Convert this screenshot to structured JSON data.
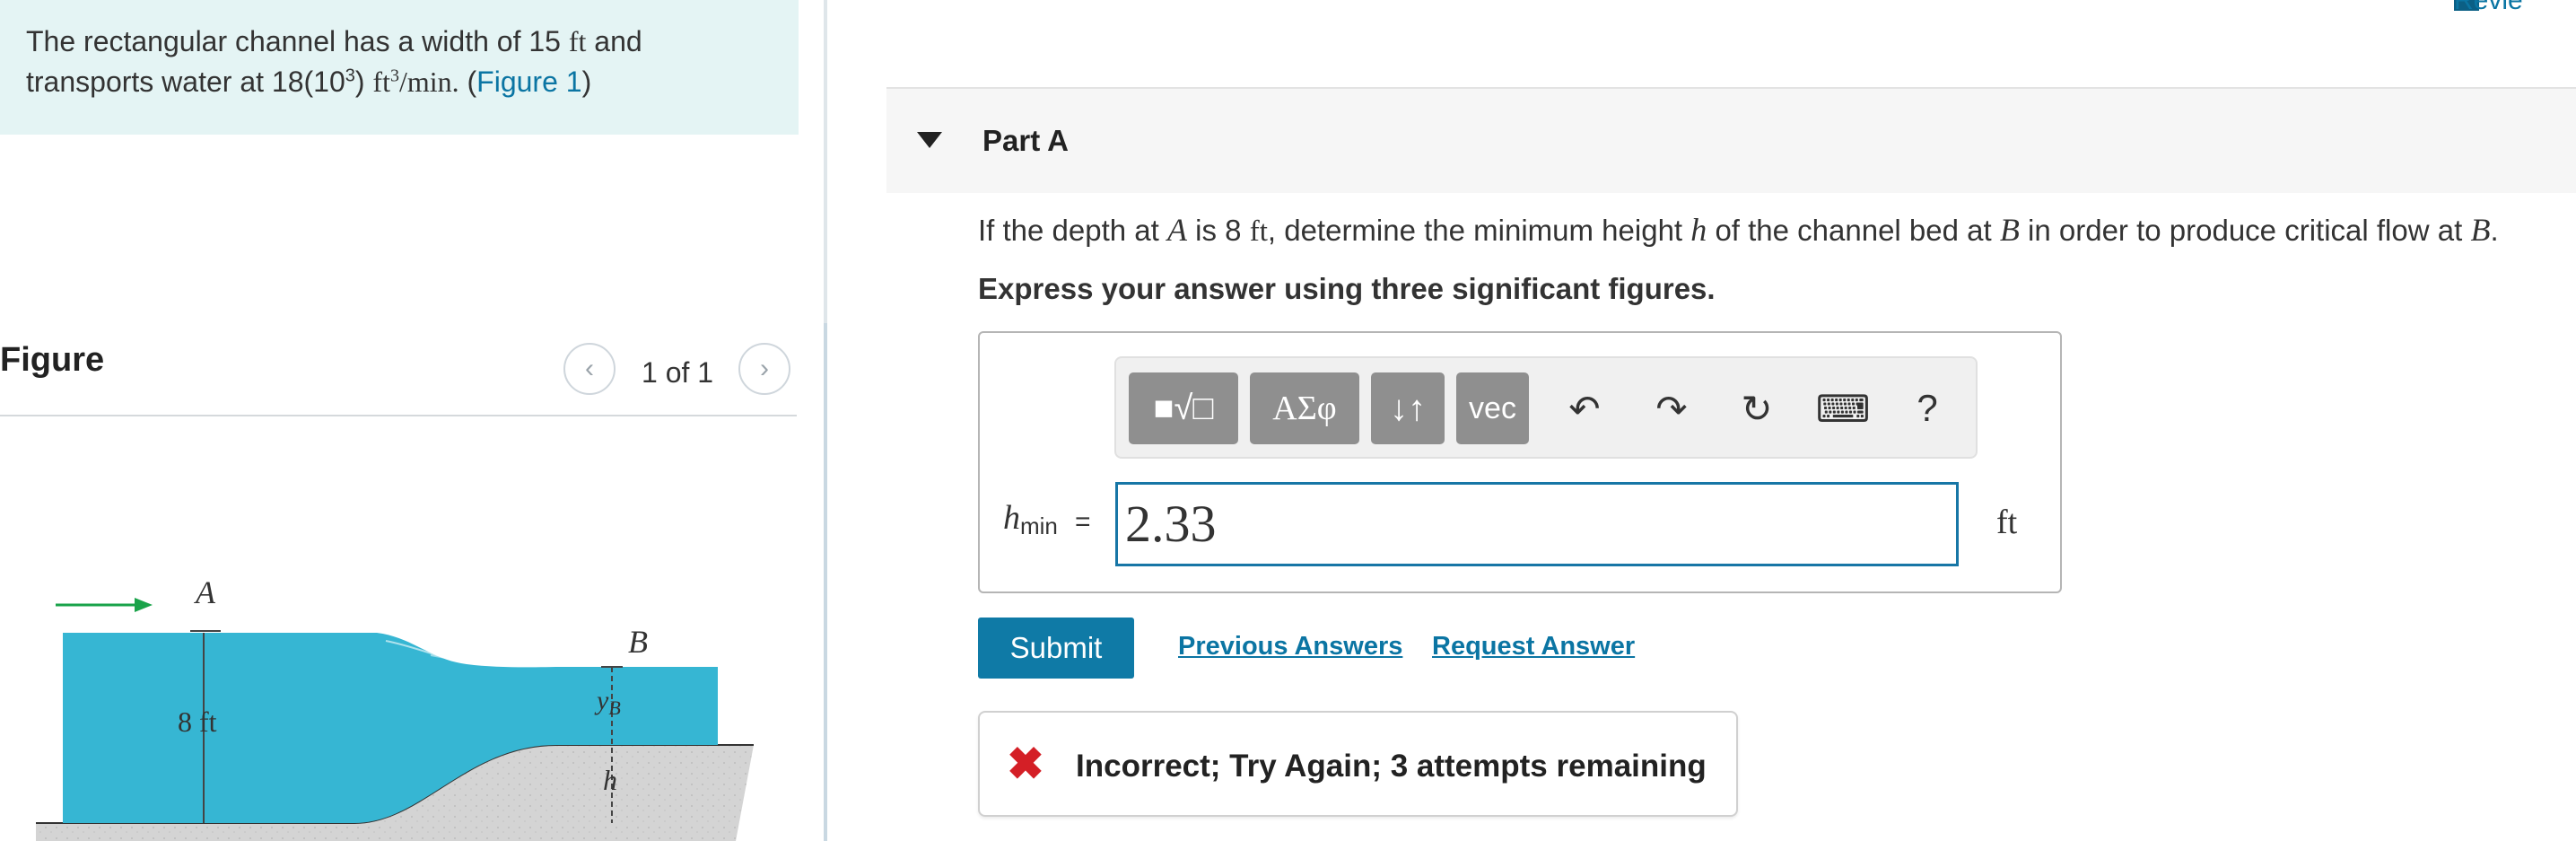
{
  "problem": {
    "line1_pre": "The rectangular channel has a width of 15",
    "line1_unit": "ft",
    "line1_post": "and",
    "line2_pre": "transports water at 18(10",
    "line2_exp": "3",
    "line2_mid": ")",
    "line2_unit": "ft",
    "line2_unit_exp": "3",
    "line2_rate": "/min.",
    "line2_open": "(",
    "figure_link": "Figure 1",
    "line2_close": ")"
  },
  "figure": {
    "title": "Figure",
    "counter": "1 of 1",
    "label_A": "A",
    "label_B": "B",
    "label_depth": "8 ft",
    "label_yB": "y",
    "label_yB_sub": "B",
    "label_h": "h"
  },
  "header": {
    "review_label": "Revie"
  },
  "part": {
    "label": "Part A",
    "question_1": "If the depth at",
    "question_A": "A",
    "question_2": "is 8",
    "question_ft": "ft",
    "question_3": ", determine the minimum height",
    "question_h": "h",
    "question_4": "of the channel bed at",
    "question_B": "B",
    "question_5": "in order to produce critical flow at",
    "question_B2": "B",
    "question_6": ".",
    "instruction": "Express your answer using three significant figures."
  },
  "toolbar": {
    "templates": "■√□",
    "symbols": "ΑΣφ",
    "arrows": "↓↑",
    "vec": "vec",
    "help": "?"
  },
  "answer": {
    "var": "h",
    "var_sub": "min",
    "equals": "=",
    "value": "2.33",
    "unit": "ft"
  },
  "actions": {
    "submit": "Submit",
    "previous_answers": "Previous Answers",
    "request_answer": "Request Answer"
  },
  "feedback": {
    "icon": "✖",
    "text": "Incorrect; Try Again; 3 attempts remaining",
    "status_color": "#d41f26"
  },
  "colors": {
    "accent": "#0f7aa6",
    "problem_bg": "#e4f4f4",
    "water": "#36b6d3"
  }
}
